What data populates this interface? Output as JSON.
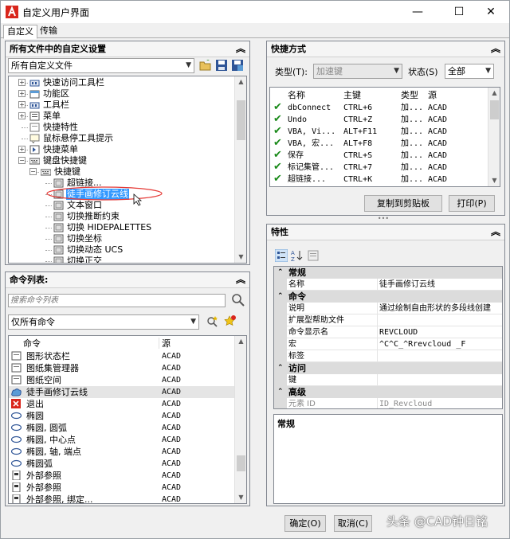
{
  "window": {
    "title": "自定义用户界面",
    "minimize": "—",
    "maximize": "☐",
    "close": "✕"
  },
  "tabs": [
    "自定义",
    "传输"
  ],
  "customizations": {
    "header": "所有文件中的自定义设置",
    "file_select": "所有自定义文件",
    "tree": [
      {
        "label": "快速访问工具栏",
        "level": 2,
        "expander": "+",
        "icon": "toolbar-icon"
      },
      {
        "label": "功能区",
        "level": 2,
        "expander": "+",
        "icon": "ribbon-icon"
      },
      {
        "label": "工具栏",
        "level": 2,
        "expander": "+",
        "icon": "toolbar-icon"
      },
      {
        "label": "菜单",
        "level": 2,
        "expander": "+",
        "icon": "menu-icon"
      },
      {
        "label": "快捷特性",
        "level": 2,
        "expander": "",
        "icon": "quick-properties-icon"
      },
      {
        "label": "鼠标悬停工具提示",
        "level": 2,
        "expander": "",
        "icon": "rollover-tooltip-icon"
      },
      {
        "label": "快捷菜单",
        "level": 2,
        "expander": "+",
        "icon": "shortcut-menu-icon"
      },
      {
        "label": "键盘快捷键",
        "level": 2,
        "expander": "−",
        "icon": "keyboard-icon"
      },
      {
        "label": "快捷键",
        "level": 3,
        "expander": "−",
        "icon": "keyboard-icon"
      },
      {
        "label": "超链接...",
        "level": 4,
        "expander": "",
        "icon": "key-icon"
      },
      {
        "label": "徒手画修订云线",
        "level": 4,
        "expander": "",
        "icon": "key-icon",
        "selected": true
      },
      {
        "label": "文本窗口",
        "level": 4,
        "expander": "",
        "icon": "key-icon"
      },
      {
        "label": "切换推断约束",
        "level": 4,
        "expander": "",
        "icon": "key-icon"
      },
      {
        "label": "切换 HIDEPALETTES",
        "level": 4,
        "expander": "",
        "icon": "key-icon"
      },
      {
        "label": "切换坐标",
        "level": 4,
        "expander": "",
        "icon": "key-icon"
      },
      {
        "label": "切换动态 UCS",
        "level": 4,
        "expander": "",
        "icon": "key-icon"
      },
      {
        "label": "切换正交",
        "level": 4,
        "expander": "",
        "icon": "key-icon"
      }
    ]
  },
  "command_list": {
    "header": "命令列表:",
    "search_placeholder": "搜索命令列表",
    "filter": "仅所有命令",
    "columns": [
      "命令",
      "源"
    ],
    "rows": [
      {
        "name": "图形状态栏",
        "source": "ACAD"
      },
      {
        "name": "图纸集管理器",
        "source": "ACAD"
      },
      {
        "name": "图纸空间",
        "source": "ACAD"
      },
      {
        "name": "徒手画修订云线",
        "source": "ACAD",
        "selected": true
      },
      {
        "name": "退出",
        "source": "ACAD"
      },
      {
        "name": "椭圆",
        "source": "ACAD"
      },
      {
        "name": "椭圆, 圆弧",
        "source": "ACAD"
      },
      {
        "name": "椭圆, 中心点",
        "source": "ACAD"
      },
      {
        "name": "椭圆, 轴, 端点",
        "source": "ACAD"
      },
      {
        "name": "椭圆弧",
        "source": "ACAD"
      },
      {
        "name": "外部参照",
        "source": "ACAD"
      },
      {
        "name": "外部参照",
        "source": "ACAD"
      },
      {
        "name": "外部参照, 绑定...",
        "source": "ACAD"
      }
    ]
  },
  "shortcuts": {
    "header": "快捷方式",
    "type_label": "类型(T):",
    "type_value": "加速键",
    "status_label": "状态(S)",
    "status_value": "全部",
    "columns": [
      "名称",
      "主键",
      "类型",
      "源"
    ],
    "rows": [
      {
        "name": "dbConnect",
        "key": "CTRL+6",
        "type": "加...",
        "source": "ACAD"
      },
      {
        "name": "Undo",
        "key": "CTRL+Z",
        "type": "加...",
        "source": "ACAD"
      },
      {
        "name": "VBA, Vi...",
        "key": "ALT+F11",
        "type": "加...",
        "source": "ACAD"
      },
      {
        "name": "VBA, 宏...",
        "key": "ALT+F8",
        "type": "加...",
        "source": "ACAD"
      },
      {
        "name": "保存",
        "key": "CTRL+S",
        "type": "加...",
        "source": "ACAD"
      },
      {
        "name": "标记集管...",
        "key": "CTRL+7",
        "type": "加...",
        "source": "ACAD"
      },
      {
        "name": "超链接...",
        "key": "CTRL+K",
        "type": "加...",
        "source": "ACAD"
      }
    ],
    "copy_button": "复制到剪贴板",
    "print_button": "打印(P)"
  },
  "properties": {
    "header": "特性",
    "categories": [
      {
        "name": "常规",
        "rows": [
          {
            "name": "名称",
            "value": "徒手画修订云线"
          }
        ]
      },
      {
        "name": "命令",
        "rows": [
          {
            "name": "说明",
            "value": "通过绘制自由形状的多段线创建"
          },
          {
            "name": "扩展型帮助文件",
            "value": ""
          },
          {
            "name": "命令显示名",
            "value": "REVCLOUD"
          },
          {
            "name": "宏",
            "value": "^C^C_^Rrevcloud _F"
          },
          {
            "name": "标签",
            "value": ""
          }
        ]
      },
      {
        "name": "访问",
        "rows": [
          {
            "name": "键",
            "value": ""
          }
        ]
      },
      {
        "name": "高级",
        "rows": [
          {
            "name": "元素 ID",
            "value": "ID_Revcloud"
          }
        ]
      }
    ],
    "description_title": "常规"
  },
  "footer": {
    "ok": "确定(O)",
    "cancel": "取消(C)",
    "watermark": "头条 @CAD钟日铭"
  },
  "colors": {
    "selection": "#3399ff",
    "check": "#1a8a1a",
    "accent_red": "#d9261c"
  }
}
